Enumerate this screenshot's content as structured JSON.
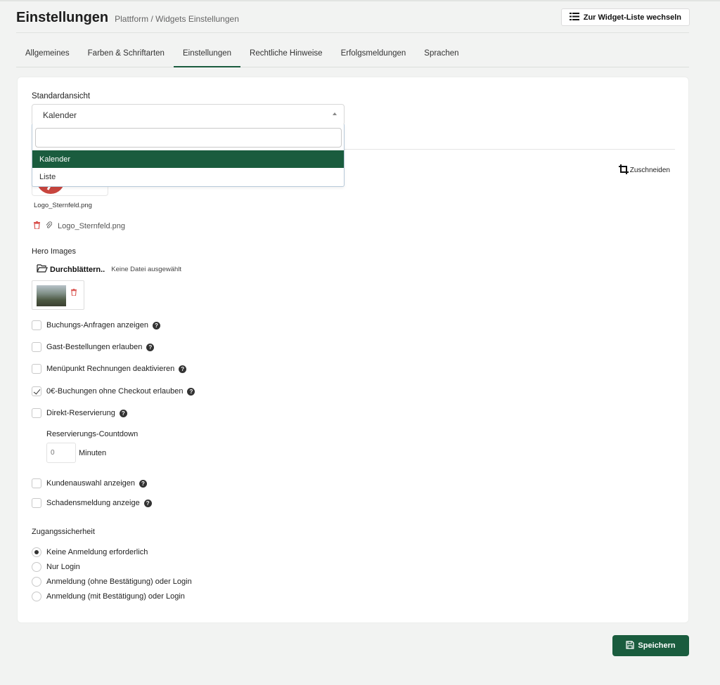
{
  "header": {
    "title": "Einstellungen",
    "subtitle": "Plattform / Widgets Einstellungen",
    "widget_list_button": "Zur Widget-Liste wechseln"
  },
  "tabs": [
    {
      "label": "Allgemeines"
    },
    {
      "label": "Farben & Schriftarten"
    },
    {
      "label": "Einstellungen",
      "active": true
    },
    {
      "label": "Rechtliche Hinweise"
    },
    {
      "label": "Erfolgsmeldungen"
    },
    {
      "label": "Sprachen"
    }
  ],
  "standard_view": {
    "label": "Standardansicht",
    "value": "Kalender",
    "search_value": "",
    "options": [
      "Kalender",
      "Liste"
    ],
    "selected_option": "Kalender"
  },
  "logo": {
    "crop_label": "Zuschneiden",
    "filename": "Logo_Sternfeld.png",
    "attachment": "Logo_Sternfeld.png"
  },
  "hero": {
    "label": "Hero Images",
    "browse_label": "Durchblättern..",
    "no_file": "Keine Datei ausgewählt"
  },
  "checkboxes": [
    {
      "label": "Buchungs-Anfragen anzeigen",
      "checked": false
    },
    {
      "label": "Gast-Bestellungen erlauben",
      "checked": false
    },
    {
      "label": "Menüpunkt Rechnungen deaktivieren",
      "checked": false
    },
    {
      "label": "0€-Buchungen ohne Checkout erlauben",
      "checked": true
    },
    {
      "label": "Direkt-Reservierung",
      "checked": false
    }
  ],
  "countdown": {
    "label": "Reservierungs-Countdown",
    "placeholder": "0",
    "unit": "Minuten"
  },
  "checkboxes2": [
    {
      "label": "Kundenauswahl anzeigen",
      "checked": false
    },
    {
      "label": "Schadensmeldung anzeige",
      "checked": false
    }
  ],
  "access": {
    "label": "Zugangssicherheit",
    "options": [
      {
        "label": "Keine Anmeldung erforderlich",
        "selected": true
      },
      {
        "label": "Nur Login",
        "selected": false
      },
      {
        "label": "Anmeldung (ohne Bestätigung) oder Login",
        "selected": false
      },
      {
        "label": "Anmeldung (mit Bestätigung) oder Login",
        "selected": false
      }
    ]
  },
  "save_label": "Speichern",
  "colors": {
    "accent": "#1a5c3e",
    "danger": "#d9534f"
  }
}
